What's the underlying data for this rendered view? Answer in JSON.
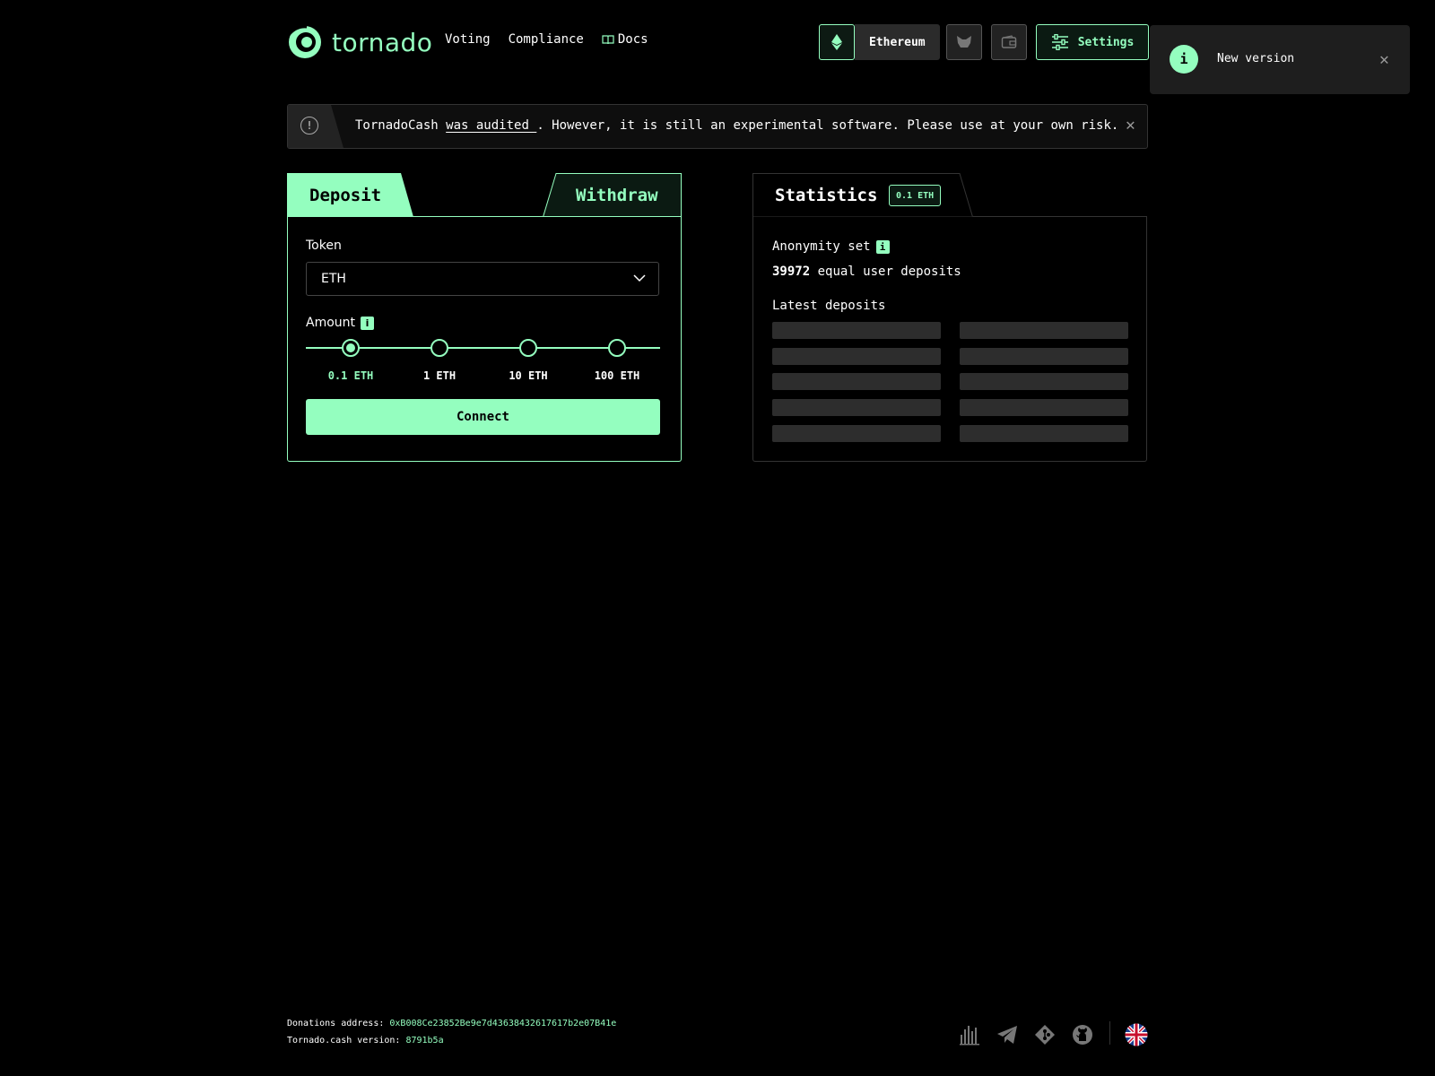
{
  "header": {
    "logo_text": "tornado",
    "nav": [
      "Voting",
      "Compliance",
      "Docs"
    ],
    "network_label": "Ethereum",
    "settings_label": "Settings"
  },
  "toast": {
    "icon": "i",
    "text": "New version"
  },
  "banner": {
    "text_before": "TornadoCash ",
    "link_text": "was audited ",
    "text_after": ". However, it is still an experimental software. Please use at your own risk."
  },
  "deposit": {
    "tabs": {
      "deposit": "Deposit",
      "withdraw": "Withdraw"
    },
    "token_label": "Token",
    "token_value": "ETH",
    "amount_label": "Amount",
    "amounts": [
      "0.1 ETH",
      "1 ETH",
      "10 ETH",
      "100 ETH"
    ],
    "selected_amount": "0.1 ETH",
    "connect_label": "Connect"
  },
  "stats": {
    "title": "Statistics",
    "badge": "0.1 ETH",
    "anonymity_label": "Anonymity set",
    "anonymity_count": "39972",
    "anonymity_suffix": " equal user deposits",
    "latest_label": "Latest deposits"
  },
  "footer": {
    "donations_label": "Donations address: ",
    "donations_address": "0xB008Ce23852Be9e7d43638432617617b2e07B41e",
    "version_label": "Tornado.cash version: ",
    "version_value": "8791b5a"
  },
  "colors": {
    "accent": "#94febf",
    "background": "#000000"
  }
}
